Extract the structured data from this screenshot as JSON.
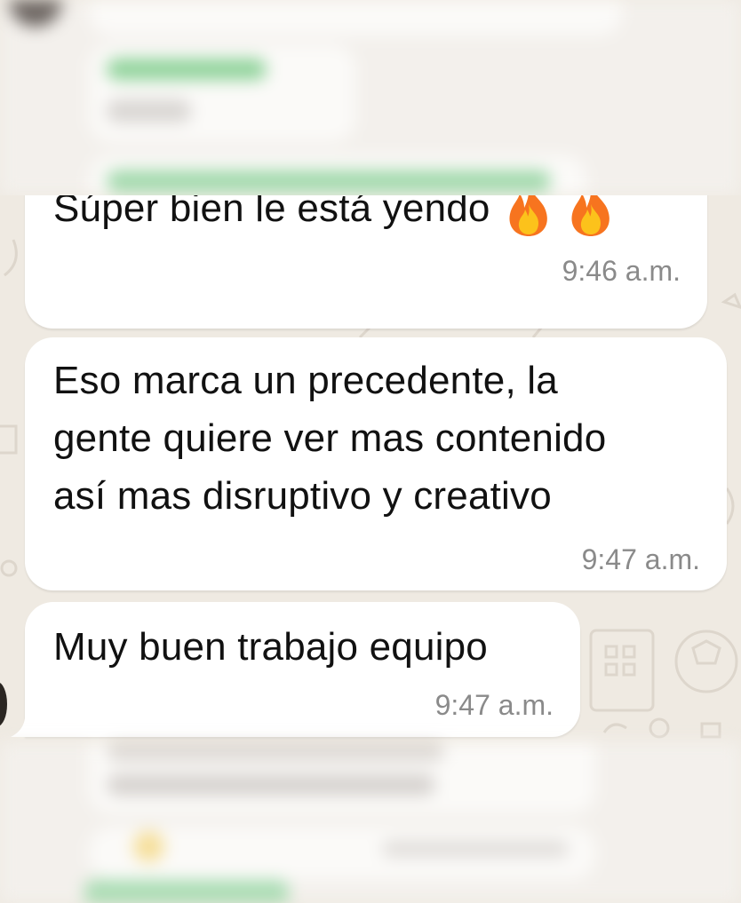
{
  "chat": {
    "messages": [
      {
        "text": "Súper bien le está yendo",
        "emojis": [
          "fire-emoji",
          "fire-emoji"
        ],
        "time": "9:46 a.m."
      },
      {
        "lines": [
          "Eso marca un precedente, la",
          "gente quiere ver mas contenido",
          "así mas disruptivo y creativo"
        ],
        "time": "9:47 a.m."
      },
      {
        "text": "Muy buen trabajo equipo",
        "time": "9:47 a.m."
      }
    ]
  },
  "colors": {
    "wallpaper": "#efeae2",
    "bubble_incoming": "#ffffff",
    "timestamp": "#8a8a8a",
    "sender_name_blurred": "#3aa55c"
  }
}
